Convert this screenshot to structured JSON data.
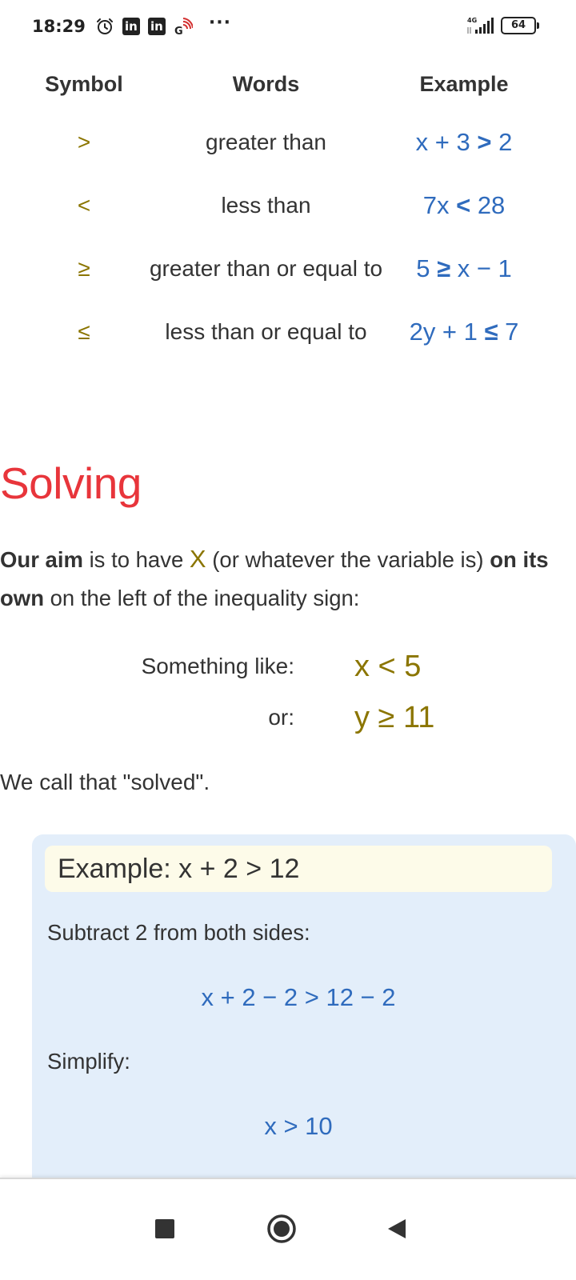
{
  "status_bar": {
    "time": "18:29",
    "network": "4G",
    "battery": "64",
    "more": "···"
  },
  "table": {
    "headers": [
      "Symbol",
      "Words",
      "Example"
    ],
    "rows": [
      {
        "symbol": ">",
        "words": "greater than",
        "example_left": "x + 3",
        "example_op": ">",
        "example_right": "2"
      },
      {
        "symbol": "<",
        "words": "less than",
        "example_left": "7x",
        "example_op": "<",
        "example_right": "28"
      },
      {
        "symbol": "≥",
        "words": "greater than or equal to",
        "example_left": "5",
        "example_op": "≥",
        "example_right": "x − 1"
      },
      {
        "symbol": "≤",
        "words": "less than or equal to",
        "example_left": "2y + 1",
        "example_op": "≤",
        "example_right": "7"
      }
    ]
  },
  "solving": {
    "title": "Solving",
    "aim_bold1": "Our aim",
    "aim_text1": "is to have",
    "aim_var": "X",
    "aim_text2": "(or whatever the variable is)",
    "aim_bold2": "on its own",
    "aim_text3": "on the left of the inequality sign:",
    "examples": [
      {
        "label": "Something like:",
        "value": "x < 5"
      },
      {
        "label": "or:",
        "value": "y ≥ 11"
      }
    ],
    "solved_text": "We call that \"solved\"."
  },
  "example_box": {
    "title": "Example: x + 2 > 12",
    "step1_text": "Subtract 2 from both sides:",
    "step1_eq": "x + 2 − 2 > 12 − 2",
    "step2_text": "Simplify:",
    "step2_eq": "x > 10"
  },
  "colors": {
    "title_red": "#e8353b",
    "variable_olive": "#8b7500",
    "example_blue": "#2f6bbd",
    "box_bg": "#e3eefa",
    "header_bg": "#fdfbe9"
  }
}
